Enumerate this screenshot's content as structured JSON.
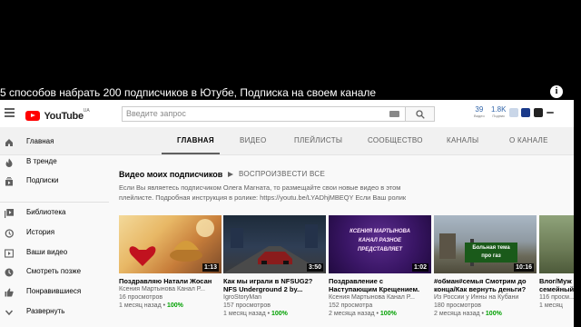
{
  "video": {
    "title": "5 способов набрать 200 подписчиков в Ютубе, Подписка на своем канале",
    "info_glyph": "i"
  },
  "header": {
    "logo_text": "YouTube",
    "logo_region": "UA",
    "search_placeholder": "Введите запрос",
    "stats": [
      {
        "value": "39",
        "caption": "Видео"
      },
      {
        "value": "1.8K",
        "caption": "Подпис"
      }
    ]
  },
  "tabs": [
    {
      "label": "ГЛАВНАЯ",
      "active": true
    },
    {
      "label": "ВИДЕО",
      "active": false
    },
    {
      "label": "ПЛЕЙЛИСТЫ",
      "active": false
    },
    {
      "label": "СООБЩЕСТВО",
      "active": false
    },
    {
      "label": "КАНАЛЫ",
      "active": false
    },
    {
      "label": "О КАНАЛЕ",
      "active": false
    }
  ],
  "sidebar": {
    "items": [
      {
        "label": "Главная",
        "icon": "home-icon"
      },
      {
        "label": "В тренде",
        "icon": "trending-icon"
      },
      {
        "label": "Подписки",
        "icon": "subscriptions-icon"
      },
      {
        "label": "Библиотека",
        "icon": "library-icon"
      },
      {
        "label": "История",
        "icon": "history-icon"
      },
      {
        "label": "Ваши видео",
        "icon": "your-videos-icon"
      },
      {
        "label": "Смотреть позже",
        "icon": "watch-later-icon"
      },
      {
        "label": "Понравившиеся",
        "icon": "liked-icon"
      },
      {
        "label": "Развернуть",
        "icon": "chevron-down-icon"
      }
    ]
  },
  "section": {
    "title": "Видео моих подписчиков",
    "play_all": "ВОСПРОИЗВЕСТИ ВСЕ",
    "description_line1": "Если Вы являетесь подписчиком Олега Магната, то размещайте свои новые видео в этом",
    "description_line2": "плейлисте. Подробная инструкция в ролике: https://youtu.be/LYADhjMBEQY Если Ваш ролик"
  },
  "videos": [
    {
      "title": "Поздравляю Натали Жосан",
      "title2": "",
      "channel": "Ксения Мартынова Канал Р...",
      "views": "16 просмотров",
      "age": "1 месяц назад",
      "badge": "100%",
      "duration": "1:13",
      "overlay1": "",
      "overlay2": ""
    },
    {
      "title": "Как мы играли в NFSUG2?",
      "title2": "NFS Underground 2 by...",
      "channel": "IgroStoryMan",
      "views": "157 просмотров",
      "age": "1 месяц назад",
      "badge": "100%",
      "duration": "3:50",
      "overlay1": "",
      "overlay2": ""
    },
    {
      "title": "Поздравление с",
      "title2": "Наступающим Крещением.",
      "channel": "Ксения Мартынова Канал Р...",
      "views": "152 просмотра",
      "age": "2 месяца назад",
      "badge": "100%",
      "duration": "1:02",
      "overlay1": "КСЕНИЯ МАРТЫНОВА",
      "overlay2": "КАНАЛ РАЗНОЕ",
      "overlay3": "ПРЕДСТАВЛЯЕТ"
    },
    {
      "title": "#обман#семья Смотрим до",
      "title2": "конца/Как вернуть деньги?",
      "channel": "Из России у Инны на Кубани",
      "views": "180 просмотров",
      "age": "2 месяца назад",
      "badge": "100%",
      "duration": "10:16",
      "overlay1": "Больная тема",
      "overlay2": "про газ"
    },
    {
      "title": "Влог/Муж",
      "title2": "семейный",
      "channel": "",
      "views": "116 просм...",
      "age": "1 месяц",
      "badge": "",
      "duration": "",
      "overlay1": "",
      "overlay2": ""
    }
  ],
  "colors": {
    "accent_red": "#ff0000",
    "new_badge": "#00a000",
    "page_bg": "#f9f9f9"
  }
}
